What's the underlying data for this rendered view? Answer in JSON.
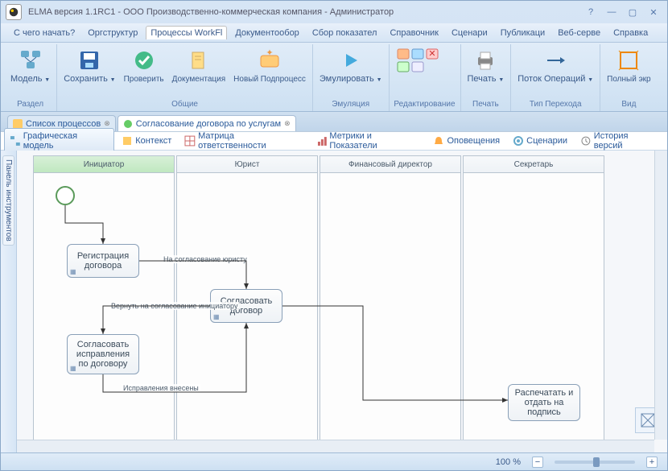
{
  "title": "ELMA версия 1.1RC1 - ООО Производственно-коммерческая компания - Администратор",
  "menu": [
    "С чего начать?",
    "Оргструктур",
    "Процессы WorkFl",
    "Документообор",
    "Сбор показател",
    "Справочник",
    "Сценари",
    "Публикаци",
    "Веб-серве",
    "Справка"
  ],
  "ribbon": {
    "groups": [
      {
        "label": "Раздел",
        "items": [
          {
            "label": "Модель"
          }
        ]
      },
      {
        "label": "Общие",
        "items": [
          {
            "label": "Сохранить"
          },
          {
            "label": "Проверить"
          },
          {
            "label": "Документация"
          },
          {
            "label": "Новый Подпроцесс"
          }
        ]
      },
      {
        "label": "Эмуляция",
        "items": [
          {
            "label": "Эмулировать"
          }
        ]
      },
      {
        "label": "Редактирование",
        "items": [
          {
            "label": ""
          }
        ]
      },
      {
        "label": "Печать",
        "items": [
          {
            "label": "Печать"
          }
        ]
      },
      {
        "label": "Тип Перехода",
        "items": [
          {
            "label": "Поток Операций"
          }
        ]
      },
      {
        "label": "Вид",
        "items": [
          {
            "label": "Полный экр"
          }
        ]
      }
    ]
  },
  "doc_tabs": [
    {
      "label": "Список процессов",
      "active": false
    },
    {
      "label": "Согласование договора по услугам",
      "active": true
    }
  ],
  "subtabs": [
    {
      "label": "Графическая модель",
      "active": true
    },
    {
      "label": "Контекст"
    },
    {
      "label": "Матрица ответственности"
    },
    {
      "label": "Метрики и Показатели"
    },
    {
      "label": "Оповещения"
    },
    {
      "label": "Сценарии"
    },
    {
      "label": "История версий"
    }
  ],
  "side_panel": "Панель инструментов",
  "lanes": [
    "Инициатор",
    "Юрист",
    "Финансовый директор",
    "Секретарь"
  ],
  "tasks": {
    "reg": "Регистрация договора",
    "approve": "Согласовать договор",
    "fix": "Согласовать исправления по договору",
    "print": "Распечатать и отдать на подпись"
  },
  "flow_labels": {
    "to_lawyer": "На согласование юристу",
    "return_init": "Вернуть на согласование инициатору",
    "fixed": "Исправления внесены"
  },
  "status": {
    "zoom": "100 %"
  }
}
